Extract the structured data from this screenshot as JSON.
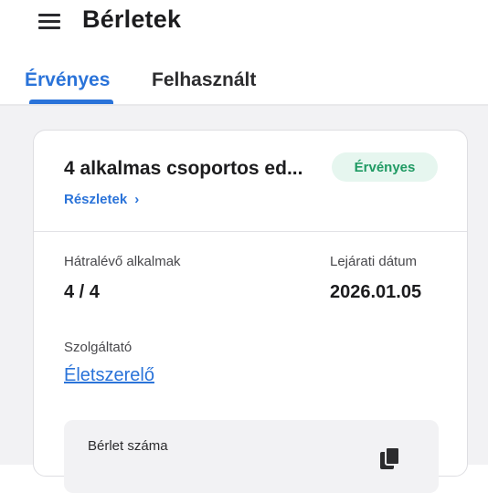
{
  "header": {
    "title": "Bérletek",
    "menu_icon": "hamburger-menu-icon"
  },
  "tabs": [
    {
      "label": "Érvényes",
      "active": true
    },
    {
      "label": "Felhasznált",
      "active": false
    }
  ],
  "colors": {
    "accent": "#2a73d9",
    "badge_bg": "#e6f6ef",
    "badge_text": "#1f9a63",
    "background": "#f2f2f4"
  },
  "card": {
    "title": "4 alkalmas csoportos ed...",
    "status_badge": "Érvényes",
    "details_link": "Részletek",
    "details_icon": "chevron-right-icon",
    "remaining_label": "Hátralévő alkalmak",
    "remaining_value": "4 / 4",
    "expiry_label": "Lejárati dátum",
    "expiry_value": "2026.01.05",
    "provider_label": "Szolgáltató",
    "provider_value": "Életszerelő",
    "pass_number_label": "Bérlet száma",
    "copy_icon": "copy-icon"
  }
}
